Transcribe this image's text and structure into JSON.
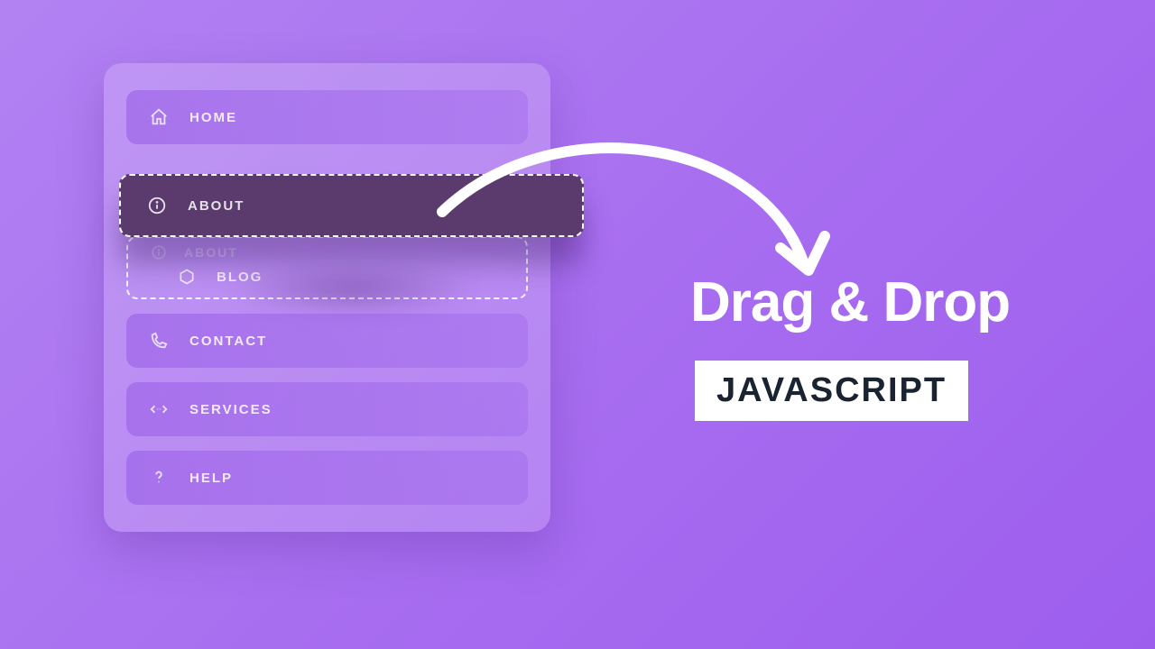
{
  "menu": {
    "items": [
      {
        "label": "HOME",
        "icon": "home"
      },
      {
        "label": "ABOUT",
        "icon": "info"
      },
      {
        "label": "BLOG",
        "icon": "hexagon"
      },
      {
        "label": "CONTACT",
        "icon": "phone"
      },
      {
        "label": "SERVICES",
        "icon": "code"
      },
      {
        "label": "HELP",
        "icon": "question"
      }
    ],
    "dragged_index": 1,
    "drop_target_index": 2
  },
  "headline": "Drag & Drop",
  "sublabel": "JAVASCRIPT"
}
